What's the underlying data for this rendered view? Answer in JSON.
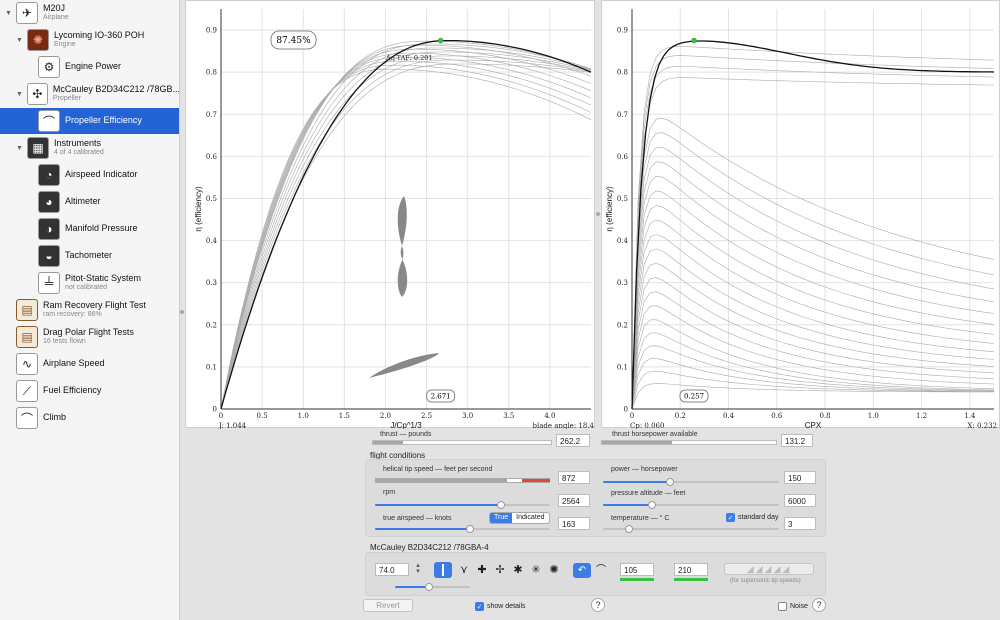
{
  "sidebar": {
    "items": [
      {
        "label": "M20J",
        "sub": "Airplane",
        "icon": "airplane-icon",
        "disclosure": true
      },
      {
        "label": "Lycoming IO-360 POH",
        "sub": "Engine",
        "icon": "engine-icon",
        "disclosure": true
      },
      {
        "label": "Engine Power",
        "sub": "",
        "icon": "engine-power-icon",
        "disclosure": false
      },
      {
        "label": "McCauley B2D34C212 /78GB...",
        "sub": "Propeller",
        "icon": "propeller-icon",
        "disclosure": true
      },
      {
        "label": "Propeller Efficiency",
        "sub": "",
        "icon": "efficiency-curve-icon",
        "disclosure": false
      },
      {
        "label": "Instruments",
        "sub": "4 of 4 calibrated",
        "icon": "instrument-panel-icon",
        "disclosure": true
      },
      {
        "label": "Airspeed Indicator",
        "sub": "",
        "icon": "airspeed-gauge-icon",
        "disclosure": false
      },
      {
        "label": "Altimeter",
        "sub": "",
        "icon": "altimeter-gauge-icon",
        "disclosure": false
      },
      {
        "label": "Manifold Pressure",
        "sub": "",
        "icon": "manifold-gauge-icon",
        "disclosure": false
      },
      {
        "label": "Tachometer",
        "sub": "",
        "icon": "tachometer-gauge-icon",
        "disclosure": false
      },
      {
        "label": "Pitot-Static System",
        "sub": "not calibrated",
        "icon": "pitot-static-icon",
        "disclosure": false
      },
      {
        "label": "Ram Recovery Flight Test",
        "sub": "ram recovery: 86%",
        "icon": "clipboard-icon",
        "disclosure": false
      },
      {
        "label": "Drag Polar Flight Tests",
        "sub": "16 tests flown",
        "icon": "clipboard-icon",
        "disclosure": false
      },
      {
        "label": "Airplane Speed",
        "sub": "",
        "icon": "speed-curve-icon",
        "disclosure": false
      },
      {
        "label": "Fuel Efficiency",
        "sub": "",
        "icon": "fuel-curve-icon",
        "disclosure": false
      },
      {
        "label": "Climb",
        "sub": "",
        "icon": "climb-curve-icon",
        "disclosure": false
      }
    ]
  },
  "chart_data": [
    {
      "type": "line",
      "title": "",
      "xlabel": "J/Cp^1/3",
      "ylabel": "η (efficiency)",
      "xlim": [
        0,
        4.5
      ],
      "ylim": [
        0,
        0.95
      ],
      "xticks": [
        "0",
        "0.5",
        "1.0",
        "1.5",
        "2.0",
        "2.5",
        "3.0",
        "3.5",
        "4.0"
      ],
      "yticks": [
        "0",
        "0.1",
        "0.2",
        "0.3",
        "0.4",
        "0.5",
        "0.6",
        "0.7",
        "0.8",
        "0.9"
      ],
      "badge": "87.45%",
      "annotation": "Δη TAF: 0.201",
      "x_readout": "2.671",
      "bottom_left": "J: 1.044",
      "bottom_right": "blade angle: 18.4",
      "operating_point": {
        "x": 2.671,
        "y": 0.875
      },
      "highlighted_series": {
        "name": "",
        "peak_x": 2.75,
        "peak_y": 0.875,
        "end_y": 0.8
      },
      "family_count": 14
    },
    {
      "type": "line",
      "title": "",
      "xlabel": "CPX",
      "ylabel": "η (efficiency)",
      "xlim": [
        0,
        1.5
      ],
      "ylim": [
        0,
        0.95
      ],
      "xticks": [
        "0",
        "0.2",
        "0.4",
        "0.6",
        "0.8",
        "1.0",
        "1.2",
        "1.4"
      ],
      "yticks": [
        "0",
        "0.1",
        "0.2",
        "0.3",
        "0.4",
        "0.5",
        "0.6",
        "0.7",
        "0.8",
        "0.9"
      ],
      "x_readout": "0.257",
      "bottom_left": "Cp: 0.060",
      "bottom_right": "X: 0.232",
      "operating_point": {
        "x": 0.257,
        "y": 0.875
      },
      "family_count": 24
    }
  ],
  "thrust": {
    "label": "thrust — pounds",
    "value": "262.2",
    "fraction": 0.17
  },
  "thrust_hp": {
    "label": "thrust horsepower available",
    "value": "131.2",
    "fraction": 0.4
  },
  "flight": {
    "title": "flight conditions",
    "tip_speed": {
      "label": "helical tip speed — feet per second",
      "value": "872"
    },
    "rpm": {
      "label": "rpm",
      "value": "2564",
      "fraction": 0.72
    },
    "tas": {
      "label": "true airspeed — knots",
      "value": "163",
      "fraction": 0.54,
      "mode_true": "True",
      "mode_indicated": "Indicated"
    },
    "power": {
      "label": "power — horsepower",
      "value": "150",
      "fraction": 0.38
    },
    "altitude": {
      "label": "pressure altitude — feet",
      "value": "6000",
      "fraction": 0.28
    },
    "temperature": {
      "label": "temperature — ° C",
      "value": "3",
      "fraction": 0.15,
      "standard_day": "standard day"
    }
  },
  "propeller": {
    "title": "McCauley B2D34C212 /78GBA-4",
    "diameter": "74.0",
    "diameter_fraction": 0.45,
    "blade_counts": [
      "1",
      "2",
      "3",
      "4",
      "5",
      "6",
      "7"
    ],
    "field_a": "105",
    "field_b": "210",
    "supersonic_label": "(for supersonic tip speeds)"
  },
  "footer": {
    "revert": "Revert",
    "show_details": "show details",
    "noise": "Noise",
    "help": "?"
  },
  "colors": {
    "accent": "#3d7be6",
    "selection": "#2463d6",
    "operating_point": "#38c145",
    "warning": "#e04a2f"
  }
}
